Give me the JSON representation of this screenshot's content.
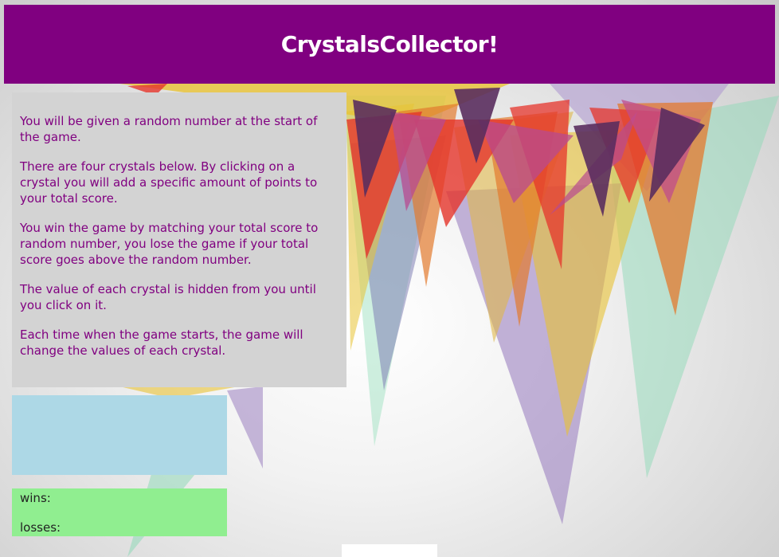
{
  "header": {
    "title": "CrystalsCollector!"
  },
  "instructions": {
    "paragraphs": [
      "You will be given a random number at the start of the game.",
      "There are four crystals below. By clicking on a crystal you will add a specific amount of points to your total score.",
      "You win the game by matching your total score to random number, you lose the game if your total score goes above the random number.",
      "The value of each crystal is hidden from you until you click on it.",
      "Each time when the game starts, the game will change the values of each crystal."
    ]
  },
  "target": {
    "value": ""
  },
  "scoreboard": {
    "wins_label": "wins:",
    "wins_value": "",
    "losses_label": "losses:",
    "losses_value": ""
  },
  "colors": {
    "header_bg": "#800080",
    "text_purple": "#800080",
    "instructions_bg": "#d3d3d3",
    "target_bg": "#add8e6",
    "score_bg": "#90ee90"
  }
}
